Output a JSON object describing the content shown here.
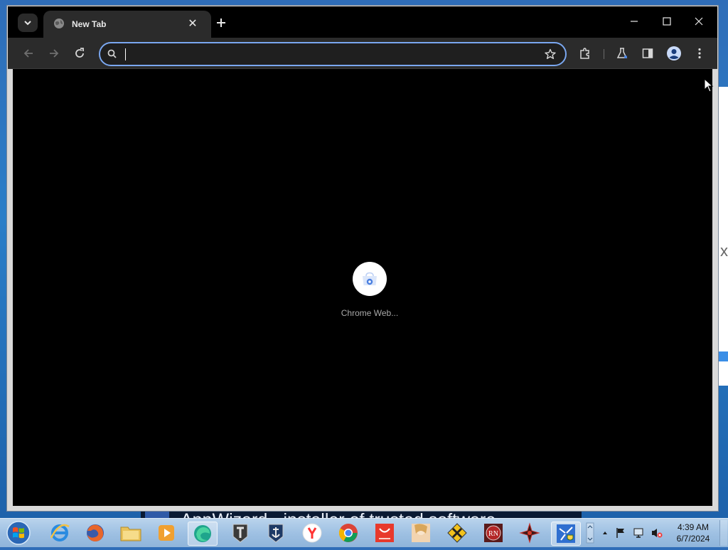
{
  "browser": {
    "tab_title": "New Tab",
    "tab_search_icon": "chevron-down-icon",
    "new_tab_icon": "plus-icon",
    "controls": {
      "minimize_icon": "minimize-icon",
      "maximize_icon": "maximize-icon",
      "close_icon": "close-icon"
    },
    "toolbar": {
      "back_icon": "back-arrow-icon",
      "forward_icon": "forward-arrow-icon",
      "reload_icon": "reload-icon",
      "omnibox_value": "",
      "omnibox_placeholder": "",
      "bookmark_icon": "star-icon",
      "extensions_icon": "puzzle-icon",
      "labs_icon": "flask-icon",
      "side_panel_icon": "side-panel-icon",
      "profile_icon": "avatar-icon",
      "menu_icon": "kebab-menu-icon"
    }
  },
  "new_tab_page": {
    "shortcuts": [
      {
        "label": "Chrome Web...",
        "icon": "chrome-web-store-icon"
      }
    ]
  },
  "background": {
    "banner_text": "AppWizard - installer of trusted software"
  },
  "taskbar": {
    "apps": [
      "start-orb",
      "internet-explorer",
      "firefox",
      "file-explorer",
      "media-player",
      "edge",
      "world-of-tanks",
      "world-of-warships",
      "yandex-browser",
      "chrome",
      "aliexpress",
      "game-anime",
      "crossout",
      "rn-app",
      "arrows-app",
      "network-wizard"
    ],
    "tray_icons": [
      "show-hidden-icons",
      "flag-icon",
      "network-icon",
      "volume-muted-icon"
    ],
    "clock": {
      "time": "4:39 AM",
      "date": "6/7/2024"
    }
  },
  "colors": {
    "accent": "#7aa7f0",
    "titlebar": "#000000",
    "toolbar": "#2b2b2b",
    "content": "#000000"
  }
}
